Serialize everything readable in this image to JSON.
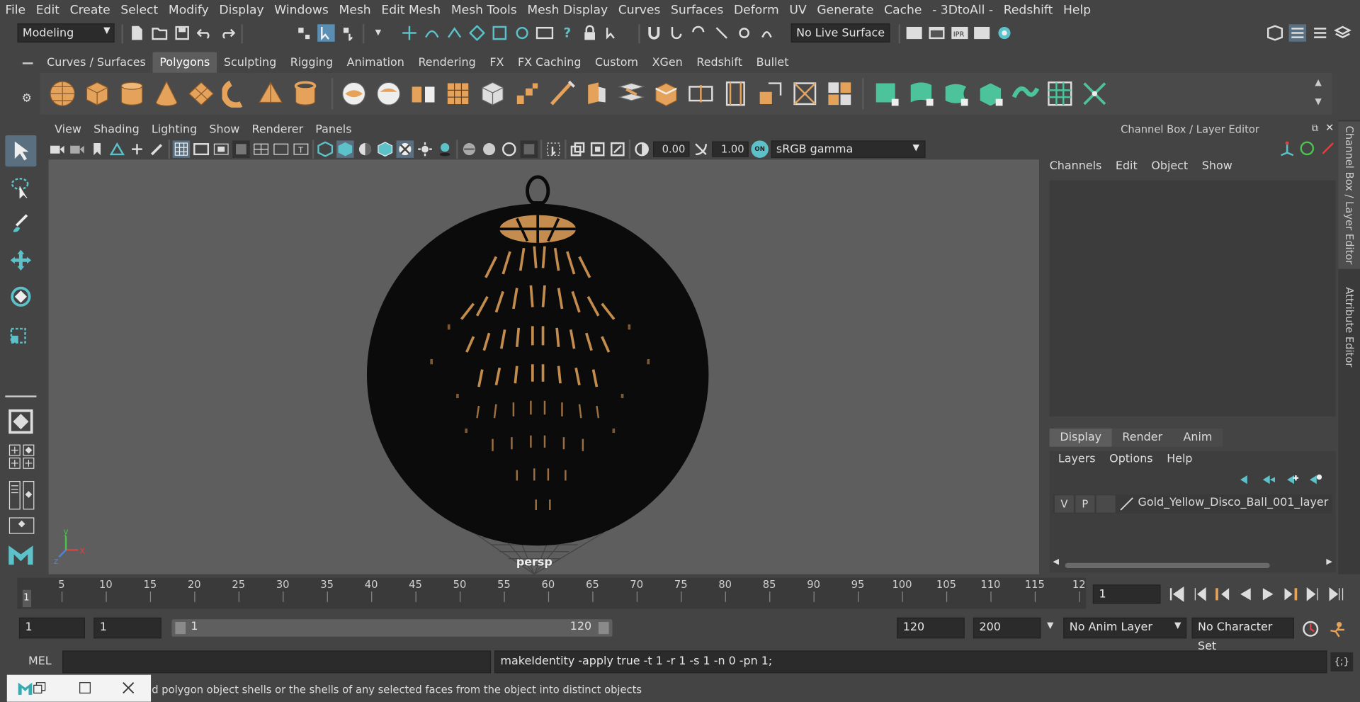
{
  "menubar": [
    "File",
    "Edit",
    "Create",
    "Select",
    "Modify",
    "Display",
    "Windows",
    "Mesh",
    "Edit Mesh",
    "Mesh Tools",
    "Mesh Display",
    "Curves",
    "Surfaces",
    "Deform",
    "UV",
    "Generate",
    "Cache",
    "- 3DtoAll -",
    "Redshift",
    "Help"
  ],
  "status": {
    "mode": "Modeling",
    "live_surface": "No Live Surface"
  },
  "shelf_tabs": [
    "Curves / Surfaces",
    "Polygons",
    "Sculpting",
    "Rigging",
    "Animation",
    "Rendering",
    "FX",
    "FX Caching",
    "Custom",
    "XGen",
    "Redshift",
    "Bullet"
  ],
  "shelf_active": "Polygons",
  "viewport": {
    "menu": [
      "View",
      "Shading",
      "Lighting",
      "Show",
      "Renderer",
      "Panels"
    ],
    "exposure": "0.00",
    "gamma": "1.00",
    "colorspace": "sRGB gamma",
    "camera_label": "persp",
    "axis_x": "x",
    "axis_y": "y",
    "axis_z": "z"
  },
  "channel_box": {
    "title": "Channel Box / Layer Editor",
    "menu": [
      "Channels",
      "Edit",
      "Object",
      "Show"
    ],
    "layer_tabs": [
      "Display",
      "Render",
      "Anim"
    ],
    "layer_tab_active": "Display",
    "layer_menu": [
      "Layers",
      "Options",
      "Help"
    ],
    "layer": {
      "v": "V",
      "p": "P",
      "name": "Gold_Yellow_Disco_Ball_001_layer"
    }
  },
  "side_tabs": [
    "Channel Box / Layer Editor",
    "Attribute Editor"
  ],
  "timeline": {
    "ticks": [
      "5",
      "10",
      "15",
      "20",
      "25",
      "30",
      "35",
      "40",
      "45",
      "50",
      "55",
      "60",
      "65",
      "70",
      "75",
      "80",
      "85",
      "90",
      "95",
      "100",
      "105",
      "110",
      "115",
      "12"
    ],
    "current": "1",
    "current_field": "1"
  },
  "range": {
    "start": "1",
    "playback_start": "1",
    "slider_start": "1",
    "slider_end": "120",
    "playback_end": "120",
    "end": "200",
    "anim_layer": "No Anim Layer",
    "character_set": "No Character Set"
  },
  "command": {
    "lang": "MEL",
    "output": "makeIdentity -apply true -t 1 -r 1 -s 1 -n 0 -pn 1;"
  },
  "help_line": "d polygon object shells or the shells of any selected faces from the object into distinct objects",
  "colors": {
    "accent": "#5dc1c9",
    "shelf_orange": "#e5a25a",
    "shelf_green": "#4cc39b"
  }
}
